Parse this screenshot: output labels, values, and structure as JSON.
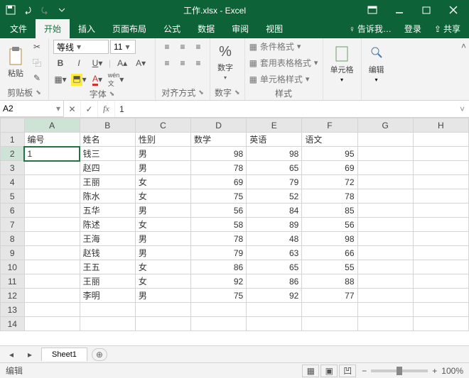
{
  "title": "工作.xlsx - Excel",
  "tabs": [
    "文件",
    "开始",
    "插入",
    "页面布局",
    "公式",
    "数据",
    "审阅",
    "视图"
  ],
  "active_tab": 1,
  "tellme": "告诉我…",
  "signin": "登录",
  "share": "共享",
  "ribbon": {
    "clipboard": {
      "label": "剪贴板",
      "paste": "粘贴"
    },
    "font": {
      "label": "字体",
      "name": "等线",
      "size": "11"
    },
    "align": {
      "label": "对齐方式"
    },
    "number": {
      "label": "数字",
      "btn": "%",
      "big": "数字"
    },
    "styles": {
      "label": "样式",
      "cond": "条件格式",
      "tbl": "套用表格格式",
      "cell": "单元格样式"
    },
    "cells": {
      "label": "单元格"
    },
    "editing": {
      "label": "编辑"
    }
  },
  "namebox": "A2",
  "formula": "1",
  "columns": [
    "A",
    "B",
    "C",
    "D",
    "E",
    "F",
    "G",
    "H"
  ],
  "headers": [
    "编号",
    "姓名",
    "性别",
    "数学",
    "英语",
    "语文"
  ],
  "rows": [
    {
      "n": 2,
      "a": "1",
      "b": "钱三",
      "c": "男",
      "d": 98,
      "e": 98,
      "f": 95
    },
    {
      "n": 3,
      "a": "",
      "b": "赵四",
      "c": "男",
      "d": 78,
      "e": 65,
      "f": 69
    },
    {
      "n": 4,
      "a": "",
      "b": "王丽",
      "c": "女",
      "d": 69,
      "e": 79,
      "f": 72
    },
    {
      "n": 5,
      "a": "",
      "b": "陈水",
      "c": "女",
      "d": 75,
      "e": 52,
      "f": 78
    },
    {
      "n": 6,
      "a": "",
      "b": "五华",
      "c": "男",
      "d": 56,
      "e": 84,
      "f": 85
    },
    {
      "n": 7,
      "a": "",
      "b": "陈述",
      "c": "女",
      "d": 58,
      "e": 89,
      "f": 56
    },
    {
      "n": 8,
      "a": "",
      "b": "王海",
      "c": "男",
      "d": 78,
      "e": 48,
      "f": 98
    },
    {
      "n": 9,
      "a": "",
      "b": "赵钱",
      "c": "男",
      "d": 79,
      "e": 63,
      "f": 66
    },
    {
      "n": 10,
      "a": "",
      "b": "王五",
      "c": "女",
      "d": 86,
      "e": 65,
      "f": 55
    },
    {
      "n": 11,
      "a": "",
      "b": "王丽",
      "c": "女",
      "d": 92,
      "e": 86,
      "f": 88
    },
    {
      "n": 12,
      "a": "",
      "b": "李明",
      "c": "男",
      "d": 75,
      "e": 92,
      "f": 77
    }
  ],
  "sheet": "Sheet1",
  "status": "编辑",
  "zoom": "100%"
}
